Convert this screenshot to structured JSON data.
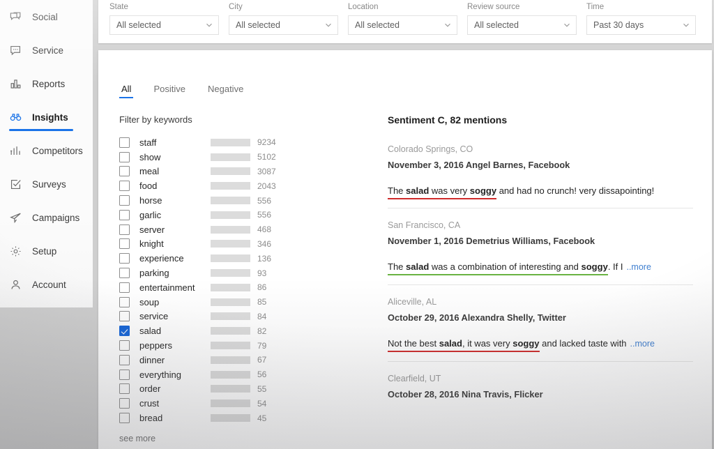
{
  "sidebar": {
    "items": [
      {
        "label": "Social",
        "icon": "chat-bubbles-icon",
        "active": false
      },
      {
        "label": "Service",
        "icon": "message-dots-icon",
        "active": false
      },
      {
        "label": "Reports",
        "icon": "bar-chart-icon",
        "active": false
      },
      {
        "label": "Insights",
        "icon": "binoculars-icon",
        "active": true
      },
      {
        "label": "Competitors",
        "icon": "compare-bars-icon",
        "active": false
      },
      {
        "label": "Surveys",
        "icon": "checkbox-square-icon",
        "active": false
      },
      {
        "label": "Campaigns",
        "icon": "paper-plane-icon",
        "active": false
      },
      {
        "label": "Setup",
        "icon": "gear-icon",
        "active": false
      },
      {
        "label": "Account",
        "icon": "person-icon",
        "active": false
      }
    ]
  },
  "filters": [
    {
      "label": "State",
      "value": "All selected"
    },
    {
      "label": "City",
      "value": "All selected"
    },
    {
      "label": "Location",
      "value": "All selected"
    },
    {
      "label": "Review source",
      "value": "All selected"
    },
    {
      "label": "Time",
      "value": "Past 30 days"
    }
  ],
  "tabs": [
    {
      "label": "All",
      "active": true
    },
    {
      "label": "Positive",
      "active": false
    },
    {
      "label": "Negative",
      "active": false
    }
  ],
  "keyword_panel": {
    "title": "Filter by keywords",
    "see_more": "see more",
    "rows": [
      {
        "name": "staff",
        "count": "9234",
        "checked": false,
        "fill_pct": 100,
        "color": "#1f7a2e"
      },
      {
        "name": "show",
        "count": "5102",
        "checked": false,
        "fill_pct": 100,
        "color": "#4cb05a"
      },
      {
        "name": "meal",
        "count": "3087",
        "checked": false,
        "fill_pct": 100,
        "color": "#1f7a2e"
      },
      {
        "name": "food",
        "count": "2043",
        "checked": false,
        "fill_pct": 100,
        "color": "#cfe9cf"
      },
      {
        "name": "horse",
        "count": "556",
        "checked": false,
        "fill_pct": 100,
        "color": "#4cb05a"
      },
      {
        "name": "garlic",
        "count": "556",
        "checked": false,
        "fill_pct": 81,
        "color": "#1f7a2e"
      },
      {
        "name": "server",
        "count": "468",
        "checked": false,
        "fill_pct": 70,
        "color": "#4cb05a"
      },
      {
        "name": "knight",
        "count": "346",
        "checked": false,
        "fill_pct": 70,
        "color": "#1f7a2e"
      },
      {
        "name": "experience",
        "count": "136",
        "checked": false,
        "fill_pct": 23,
        "color": "#bfe3bf"
      },
      {
        "name": "parking",
        "count": "93",
        "checked": false,
        "fill_pct": 21,
        "color": "#4cb05a"
      },
      {
        "name": "entertainment",
        "count": "86",
        "checked": false,
        "fill_pct": 21,
        "color": "#1f7a2e"
      },
      {
        "name": "soup",
        "count": "85",
        "checked": false,
        "fill_pct": 21,
        "color": "#4cb05a"
      },
      {
        "name": "service",
        "count": "84",
        "checked": false,
        "fill_pct": 21,
        "color": "#1f7a2e"
      },
      {
        "name": "salad",
        "count": "82",
        "checked": true,
        "fill_pct": 21,
        "color": "#e02b20"
      },
      {
        "name": "peppers",
        "count": "79",
        "checked": false,
        "fill_pct": 21,
        "color": "#4cb05a"
      },
      {
        "name": "dinner",
        "count": "67",
        "checked": false,
        "fill_pct": 12,
        "color": "#1f7a2e"
      },
      {
        "name": "everything",
        "count": "56",
        "checked": false,
        "fill_pct": 12,
        "color": "#4cb05a"
      },
      {
        "name": "order",
        "count": "55",
        "checked": false,
        "fill_pct": 12,
        "color": "#1f7a2e"
      },
      {
        "name": "crust",
        "count": "54",
        "checked": false,
        "fill_pct": 12,
        "color": "#d9ebd9"
      },
      {
        "name": "bread",
        "count": "45",
        "checked": false,
        "fill_pct": 7,
        "color": "#4cb05a"
      }
    ]
  },
  "mentions": {
    "heading": "Sentiment C, 82 mentions",
    "more_label": "..more",
    "reviews": [
      {
        "location": "Colorado Springs, CO",
        "meta": "November 3, 2016 Angel Barnes, Facebook",
        "underline": "red",
        "pre": "The ",
        "kw1": "salad",
        "mid": " was very ",
        "kw2": "soggy",
        "post": " and had no crunch! very dissapointing!",
        "has_more": false
      },
      {
        "location": "San Francisco, CA",
        "meta": "November 1, 2016 Demetrius Williams, Facebook",
        "underline": "green",
        "pre": "The ",
        "kw1": "salad",
        "mid": " was a combination of interesting and ",
        "kw2": "soggy",
        "post": ". If I",
        "has_more": true
      },
      {
        "location": "Aliceville, AL",
        "meta": "October 29, 2016 Alexandra Shelly, Twitter",
        "underline": "red",
        "pre": "Not the best ",
        "kw1": "salad",
        "mid": ", it was very ",
        "kw2": "soggy",
        "post": " and lacked taste with",
        "has_more": true
      },
      {
        "location": "Clearfield, UT",
        "meta": "October 28, 2016 Nina Travis, Flicker",
        "underline": "none",
        "pre": "",
        "kw1": "",
        "mid": "",
        "kw2": "",
        "post": "",
        "has_more": false
      }
    ]
  },
  "colors": {
    "accent_blue": "#1a73e8",
    "green_dark": "#1f7a2e",
    "green_light": "#4cb05a",
    "red": "#e02b20",
    "track_gray": "#dcdcdc"
  }
}
